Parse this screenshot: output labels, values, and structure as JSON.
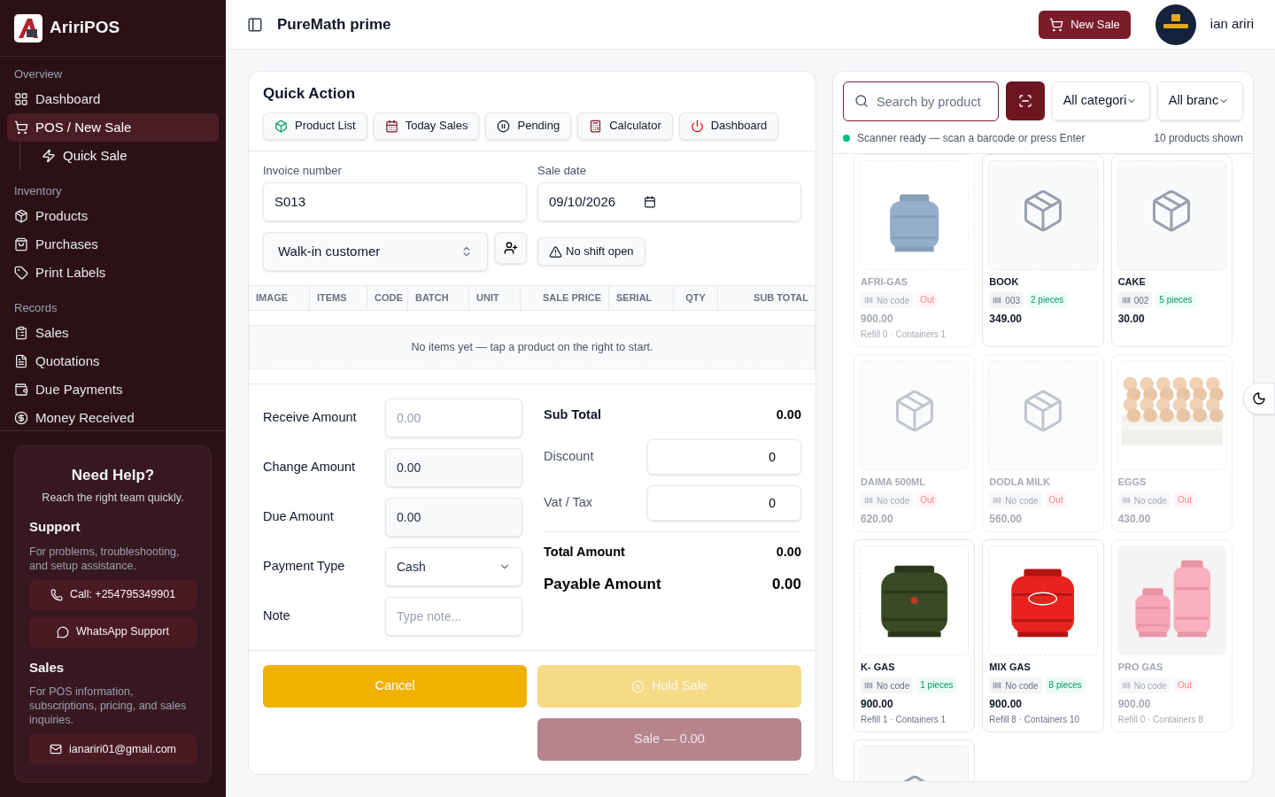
{
  "brand": "AririPOS",
  "sidebar": {
    "sections": [
      {
        "title": "Overview",
        "items": [
          {
            "label": "Dashboard",
            "selected": false
          },
          {
            "label": "POS / New Sale",
            "selected": true,
            "children": [
              {
                "label": "Quick Sale",
                "selected": false
              }
            ]
          }
        ]
      },
      {
        "title": "Inventory",
        "items": [
          {
            "label": "Products",
            "selected": false
          },
          {
            "label": "Purchases",
            "selected": false
          },
          {
            "label": "Print Labels",
            "selected": false
          }
        ]
      },
      {
        "title": "Records",
        "items": [
          {
            "label": "Sales",
            "selected": false
          },
          {
            "label": "Quotations",
            "selected": false
          },
          {
            "label": "Due Payments",
            "selected": false
          },
          {
            "label": "Money Received",
            "selected": false
          }
        ]
      }
    ]
  },
  "help": {
    "title": "Need Help?",
    "subtitle": "Reach the right team quickly.",
    "groups": [
      {
        "title": "Support",
        "text": "For problems, troubleshooting, and setup assistance.",
        "buttons": [
          "Call: +254795349901",
          "WhatsApp Support"
        ]
      },
      {
        "title": "Sales",
        "text": "For POS information, subscriptions, pricing, and sales inquiries.",
        "buttons": [
          "ianariri01@gmail.com"
        ]
      }
    ]
  },
  "header": {
    "title": "PureMath prime",
    "new_sale": "New Sale",
    "user": "ian ariri"
  },
  "quick_action": {
    "title": "Quick Action",
    "buttons": [
      "Product List",
      "Today Sales",
      "Pending",
      "Calculator",
      "Dashboard"
    ]
  },
  "invoice": {
    "label": "Invoice number",
    "value": "S013"
  },
  "sale_date": {
    "label": "Sale date",
    "value": "09/10/2026"
  },
  "customer": {
    "value": "Walk-in customer"
  },
  "shift": {
    "label": "No shift open"
  },
  "table": {
    "columns": [
      "IMAGE",
      "ITEMS",
      "CODE",
      "BATCH",
      "UNIT",
      "SALE PRICE",
      "SERIAL",
      "QTY",
      "SUB TOTAL"
    ],
    "empty": "No items yet — tap a product on the right to start."
  },
  "payment": [
    {
      "label": "Receive Amount",
      "kind": "input",
      "placeholder": "0.00"
    },
    {
      "label": "Change Amount",
      "kind": "readonly",
      "value": "0.00"
    },
    {
      "label": "Due Amount",
      "kind": "readonly",
      "value": "0.00"
    },
    {
      "label": "Payment Type",
      "kind": "select",
      "value": "Cash"
    },
    {
      "label": "Note",
      "kind": "input",
      "placeholder": "Type note..."
    }
  ],
  "summary": {
    "sub_total": {
      "label": "Sub Total",
      "value": "0.00"
    },
    "discount": {
      "label": "Discount",
      "value": "0"
    },
    "vat": {
      "label": "Vat / Tax",
      "value": "0"
    },
    "total": {
      "label": "Total Amount",
      "value": "0.00"
    },
    "payable": {
      "label": "Payable Amount",
      "value": "0.00"
    }
  },
  "actions": [
    {
      "label": "Cancel",
      "kind": "cancel",
      "disabled": false
    },
    {
      "label": "Hold Sale",
      "kind": "hold",
      "disabled": true
    },
    {
      "label": "Sale — 0.00",
      "kind": "sale",
      "disabled": true
    }
  ],
  "catalog": {
    "search": {
      "placeholder": "Search by product"
    },
    "category": "All categori",
    "branch": "All branc",
    "status": "Scanner ready — scan a barcode or press Enter",
    "count": "10 products shown",
    "products": [
      {
        "name": "AFRI-GAS",
        "kind": "picture",
        "code": "No code",
        "stock": "Out",
        "in_stock": false,
        "price": "900.00",
        "note": "Refill 0 · Containers 1"
      },
      {
        "name": "BOOK",
        "kind": "placeholder",
        "code": "003",
        "stock": "2 pieces",
        "in_stock": true,
        "price": "349.00"
      },
      {
        "name": "CAKE",
        "kind": "placeholder",
        "code": "002",
        "stock": "5 pieces",
        "in_stock": true,
        "price": "30.00"
      },
      {
        "name": "DAIMA 500ML",
        "kind": "placeholder",
        "code": "No code",
        "stock": "Out",
        "in_stock": false,
        "price": "620.00"
      },
      {
        "name": "DODLA MILK",
        "kind": "placeholder",
        "code": "No code",
        "stock": "Out",
        "in_stock": false,
        "price": "560.00"
      },
      {
        "name": "EGGS",
        "kind": "picture",
        "code": "No code",
        "stock": "Out",
        "in_stock": false,
        "price": "430.00"
      },
      {
        "name": "K- GAS",
        "kind": "picture",
        "code": "No code",
        "stock": "1 pieces",
        "in_stock": true,
        "price": "900.00",
        "note": "Refill 1 · Containers 1"
      },
      {
        "name": "MIX GAS",
        "kind": "picture",
        "code": "No code",
        "stock": "8 pieces",
        "in_stock": true,
        "price": "900.00",
        "note": "Refill 8 · Containers 10"
      },
      {
        "name": "PRO GAS",
        "kind": "picture",
        "code": "No code",
        "stock": "Out",
        "in_stock": false,
        "price": "900.00",
        "note": "Refill 0 · Containers 8"
      },
      {
        "kind": "placeholder"
      }
    ]
  }
}
